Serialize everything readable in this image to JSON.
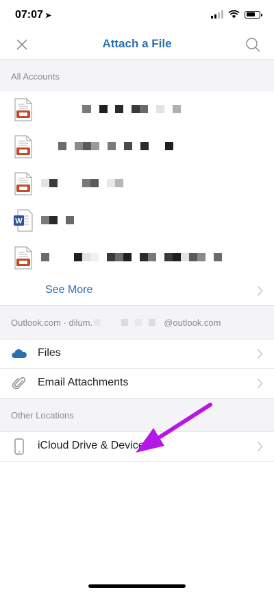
{
  "status_bar": {
    "time": "07:07"
  },
  "nav": {
    "title": "Attach a File"
  },
  "sections": {
    "all_accounts": "All Accounts",
    "outlook_account": "Outlook.com · dilum.",
    "outlook_account_suffix": "@outlook.com",
    "other_locations": "Other Locations"
  },
  "files": [
    {
      "type": "document",
      "icon": "document-icon"
    },
    {
      "type": "document",
      "icon": "document-icon"
    },
    {
      "type": "document",
      "icon": "document-icon"
    },
    {
      "type": "word",
      "icon": "word-document-icon"
    },
    {
      "type": "document",
      "icon": "document-icon"
    }
  ],
  "see_more": "See More",
  "outlook_items": [
    {
      "label": "Files",
      "icon": "onedrive-cloud-icon"
    },
    {
      "label": "Email Attachments",
      "icon": "paperclip-icon"
    }
  ],
  "other_items": [
    {
      "label": "iCloud Drive & Device",
      "icon": "phone-device-icon"
    }
  ],
  "colors": {
    "accent": "#2a6fb0",
    "annotation_arrow": "#b517e8",
    "section_bg": "#f4f4f6"
  }
}
